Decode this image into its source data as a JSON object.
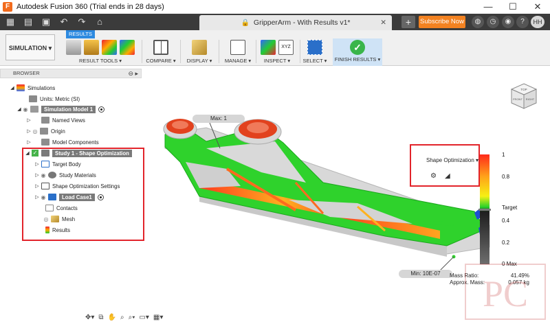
{
  "window": {
    "title": "Autodesk Fusion 360 (Trial ends in 28 days)",
    "app_icon_letter": "F",
    "minimize": "—",
    "maximize": "☐",
    "close": "✕"
  },
  "qat": {
    "document_tab": "GripperArm - With Results v1*",
    "subscribe_label": "Subscribe Now",
    "avatar_initials": "HH"
  },
  "ribbon": {
    "workspace": "SIMULATION ▾",
    "results_tab": "RESULTS",
    "groups": {
      "result_tools": "RESULT TOOLS ▾",
      "compare": "COMPARE ▾",
      "display": "DISPLAY ▾",
      "manage": "MANAGE ▾",
      "inspect": "INSPECT ▾",
      "select": "SELECT ▾",
      "finish": "FINISH RESULTS ▾"
    },
    "inspect_xyz": "XYZ"
  },
  "browser": {
    "header": "BROWSER",
    "items": [
      {
        "label": "Simulations"
      },
      {
        "label": "Units: Metric (SI)"
      },
      {
        "label": "Simulation Model 1"
      },
      {
        "label": "Named Views"
      },
      {
        "label": "Origin"
      },
      {
        "label": "Model Components"
      },
      {
        "label": "Study 1 - Shape Optimization"
      },
      {
        "label": "Target Body"
      },
      {
        "label": "Study Materials"
      },
      {
        "label": "Shape Optimization Settings"
      },
      {
        "label": "Load Case1"
      },
      {
        "label": "Contacts"
      },
      {
        "label": "Mesh"
      },
      {
        "label": "Results"
      }
    ]
  },
  "viewport": {
    "max_marker": "Max: 1",
    "min_marker": "Min: 10E-07",
    "result_menu": "Shape Optimization ▾",
    "viewcube_labels": {
      "top": "TOP",
      "front": "FRONT",
      "right": "RIGHT"
    }
  },
  "legend": {
    "ticks": [
      "1",
      "0.8",
      "Target",
      "0.4",
      "0.2",
      "0 Max"
    ],
    "target_fraction": 0.5,
    "colors": [
      "#ff2a1a",
      "#ffa21a",
      "#f6f014",
      "#26d12a",
      "#1e1e1e",
      "#6e6e6e"
    ]
  },
  "mass": {
    "ratio_label": "Mass Ratio:",
    "ratio_value": "41.49%",
    "approx_label": "Approx. Mass:",
    "approx_value": "0.057 kg"
  },
  "watermark": "PC"
}
